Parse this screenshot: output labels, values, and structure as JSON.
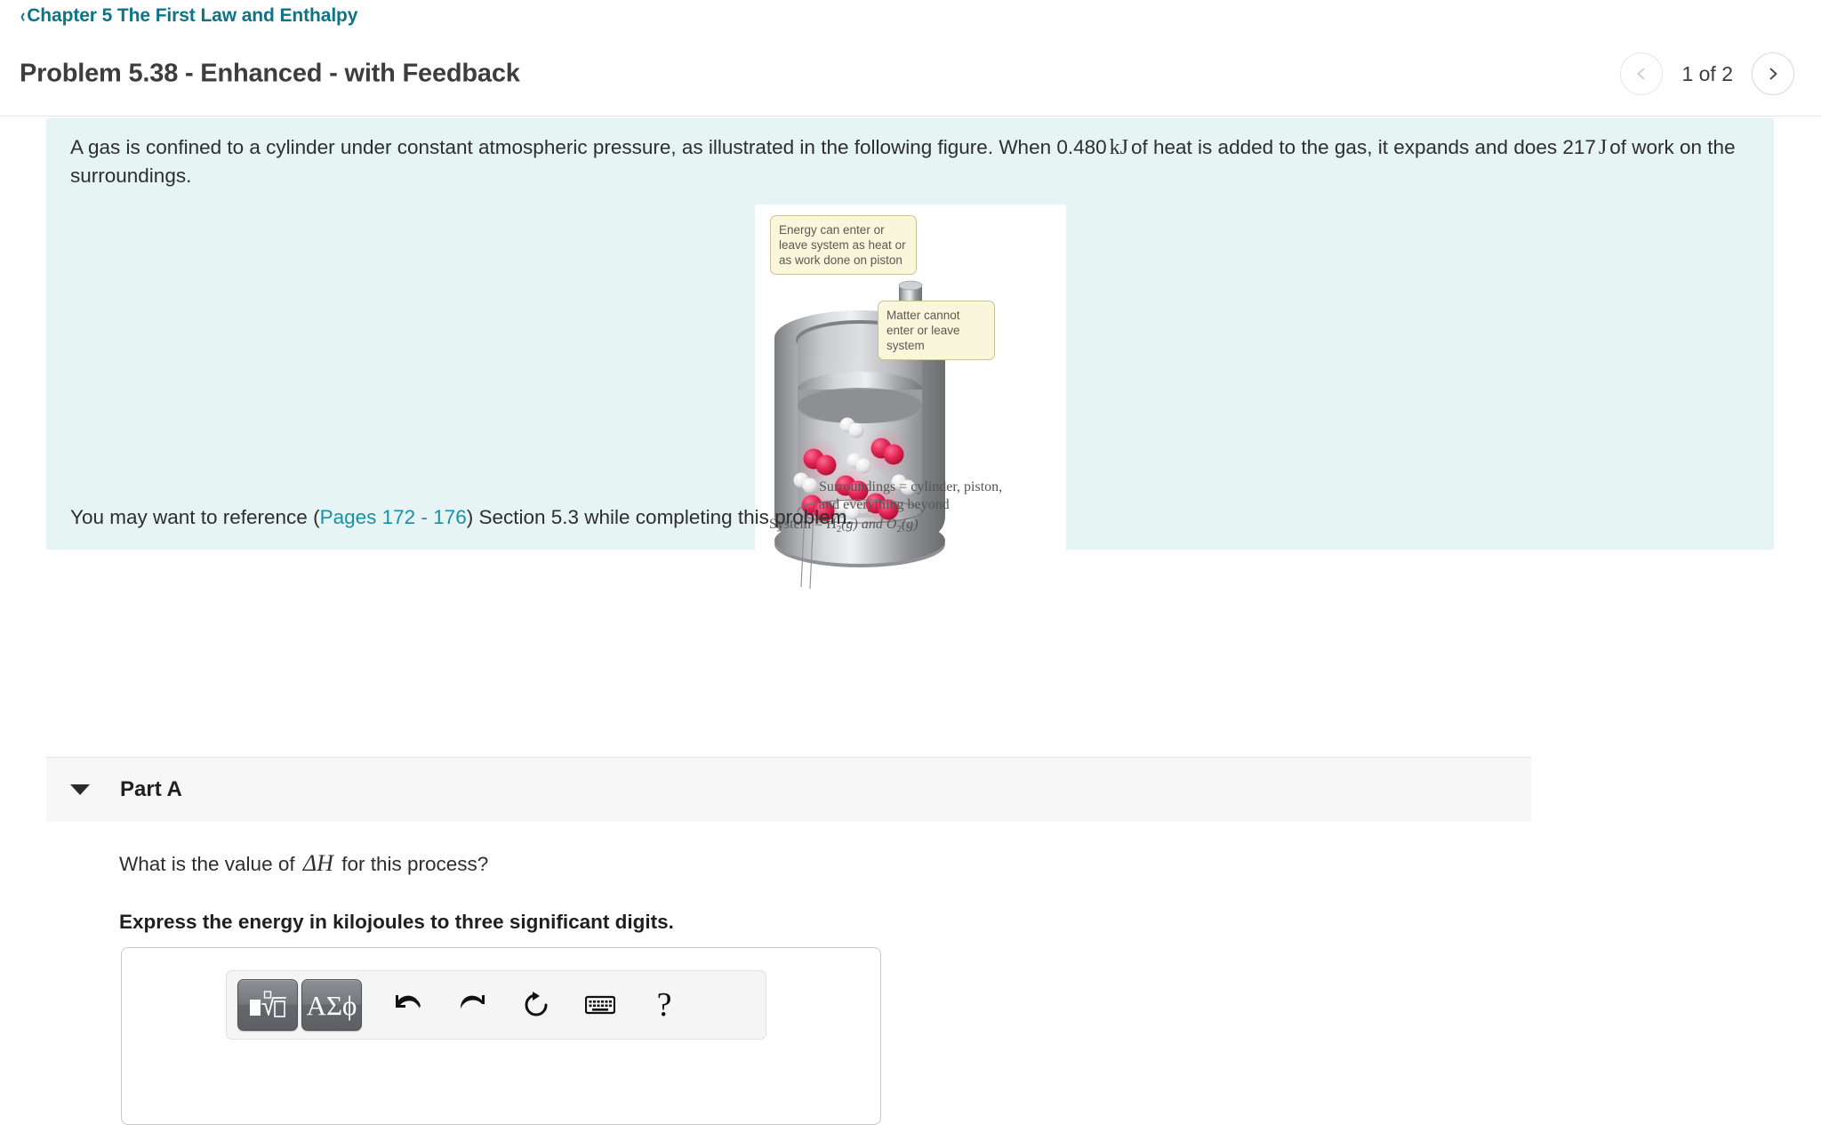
{
  "breadcrumb": {
    "chevron": "‹",
    "label": "Chapter 5 The First Law and Enthalpy"
  },
  "header": {
    "title": "Problem 5.38 - Enhanced - with Feedback",
    "pager_label": "1 of 2",
    "prev_icon": "chevron-left-icon",
    "next_icon": "chevron-right-icon"
  },
  "problem": {
    "text_part1": "A gas is confined to a cylinder under constant atmospheric pressure, as illustrated in the following figure. When 0.480",
    "unit_kj": "kJ",
    "text_part2": "of heat is added to the gas, it expands and does 217",
    "unit_j": "J",
    "text_part3": "of work on the surroundings.",
    "reference_prefix": "You may want to reference (",
    "reference_link": "Pages 172 - 176",
    "reference_suffix": ") Section 5.3 while completing this problem.",
    "background_color": "#e6f4f4",
    "link_color": "#1990a8"
  },
  "figure": {
    "callout_energy": "Energy can enter or leave system as heat or as work done on piston",
    "callout_matter": "Matter cannot enter or leave system",
    "caption_surroundings": "Surroundings = cylinder, piston, and everything beyond",
    "caption_system_prefix": "System = H",
    "caption_system_sub1": "2",
    "caption_system_mid": "(g) and O",
    "caption_system_sub2": "2",
    "caption_system_suffix": "(g)"
  },
  "part_a": {
    "caret_icon": "caret-down-icon",
    "label": "Part A",
    "question_prefix": "What is the value of",
    "question_symbol": "ΔH",
    "question_suffix": "for this process?",
    "instruction": "Express the energy in kilojoules to three significant digits."
  },
  "answer_toolbar": {
    "buttons": [
      {
        "name": "math-template-button",
        "icon": "square-root-template-icon",
        "label": ""
      },
      {
        "name": "greek-symbols-button",
        "icon": "greek-letters-icon",
        "label": "ΑΣϕ"
      },
      {
        "name": "undo-button",
        "icon": "undo-arrow-icon",
        "label": ""
      },
      {
        "name": "redo-button",
        "icon": "redo-arrow-icon",
        "label": ""
      },
      {
        "name": "reset-button",
        "icon": "reset-circular-arrow-icon",
        "label": ""
      },
      {
        "name": "keyboard-button",
        "icon": "keyboard-icon",
        "label": ""
      },
      {
        "name": "help-button",
        "icon": "question-mark-icon",
        "label": "?"
      }
    ]
  }
}
